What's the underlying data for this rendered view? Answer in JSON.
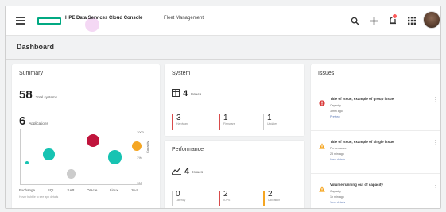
{
  "header": {
    "brand": "HPE Data Services Cloud Console",
    "context": "Fleet Management",
    "icons": [
      "menu-icon",
      "search-icon",
      "plus-icon",
      "notification-icon",
      "apps-grid-icon",
      "user-avatar"
    ]
  },
  "page": {
    "title": "Dashboard"
  },
  "summary": {
    "title": "Summary",
    "total_systems_value": "58",
    "total_systems_label": "Total systems",
    "applications_value": "6",
    "applications_label": "Applications",
    "y_ticks": [
      "1000",
      "1%",
      "100"
    ],
    "y_axis_label": "Capacity",
    "x_ticks": [
      "Exchange",
      "SQL",
      "SAP",
      "Oracle",
      "Linux",
      "Java"
    ],
    "note": "Hover bubble to see app details"
  },
  "chart_data": {
    "type": "scatter",
    "title": "",
    "xlabel": "",
    "ylabel": "Capacity",
    "categories": [
      "Exchange",
      "SQL",
      "SAP",
      "Oracle",
      "Linux",
      "Java"
    ],
    "points": [
      {
        "category": "Exchange",
        "y": 40,
        "size": 3,
        "color": "#17c3b2"
      },
      {
        "category": "SQL",
        "y": 55,
        "size": 9,
        "color": "#17c3b2"
      },
      {
        "category": "SAP",
        "y": 20,
        "size": 7,
        "color": "#cccccc"
      },
      {
        "category": "Oracle",
        "y": 80,
        "size": 10,
        "color": "#c0143c"
      },
      {
        "category": "Linux",
        "y": 50,
        "size": 11,
        "color": "#17c3b2"
      },
      {
        "category": "Java",
        "y": 70,
        "size": 8,
        "color": "#f5a623"
      }
    ]
  },
  "system": {
    "title": "System",
    "issues_value": "4",
    "issues_label": "Issues",
    "breakdown": [
      {
        "value": "3",
        "label": "Hardware",
        "color": "#d94b4b"
      },
      {
        "value": "1",
        "label": "Firmware",
        "color": "#d94b4b"
      },
      {
        "value": "1",
        "label": "Updates",
        "color": "#cccccc"
      }
    ]
  },
  "performance": {
    "title": "Performance",
    "issues_value": "4",
    "issues_label": "Issues",
    "breakdown": [
      {
        "value": "0",
        "label": "Latency",
        "color": "#cccccc"
      },
      {
        "value": "2",
        "label": "IOPS",
        "color": "#d94b4b"
      },
      {
        "value": "2",
        "label": "Utilization",
        "color": "#f5a623"
      }
    ]
  },
  "issues": {
    "title": "Issues",
    "items": [
      {
        "severity": "critical",
        "title": "Title of issue, example of group issue",
        "category": "Capacity",
        "time": "3 min ago",
        "link": "Preview"
      },
      {
        "severity": "warning",
        "title": "Title of issue, example of single issue",
        "category": "Performance",
        "time": "23 min ago",
        "link": "View details"
      },
      {
        "severity": "warning",
        "title": "Volume running out of capacity",
        "category": "Capacity",
        "time": "1h min ago",
        "link": "View details"
      }
    ]
  }
}
